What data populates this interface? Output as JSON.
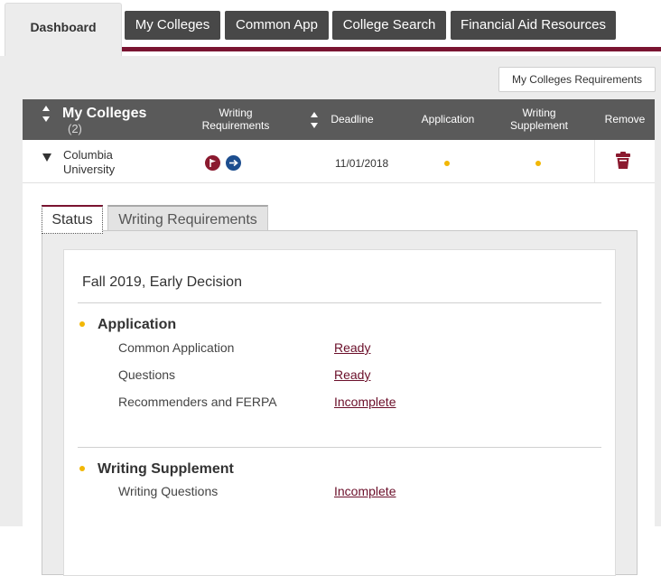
{
  "nav": {
    "tabs": [
      {
        "label": "Dashboard",
        "active": true
      },
      {
        "label": "My Colleges"
      },
      {
        "label": "Common App"
      },
      {
        "label": "College Search"
      },
      {
        "label": "Financial Aid Resources"
      }
    ]
  },
  "colors": {
    "accent": "#7a1431",
    "tab_bg": "#484848",
    "header_bg": "#5a5a5a",
    "status_dot": "#f2b705"
  },
  "requirements_button": "My Colleges Requirements",
  "table": {
    "title": "My Colleges",
    "count": "(2)",
    "columns": {
      "writing_requirements": "Writing Requirements",
      "deadline": "Deadline",
      "application": "Application",
      "writing_supplement": "Writing Supplement",
      "remove": "Remove"
    },
    "rows": [
      {
        "college": "Columbia University",
        "writing_icons": [
          "flag-icon",
          "arrow-icon"
        ],
        "deadline": "11/01/2018",
        "application_status": "in-progress",
        "writing_supplement_status": "in-progress",
        "remove_icon": "trash-icon"
      }
    ]
  },
  "detail": {
    "tabs": [
      "Status",
      "Writing Requirements"
    ],
    "term": "Fall 2019, Early Decision",
    "sections": [
      {
        "title": "Application",
        "items": [
          {
            "label": "Common Application",
            "status": "Ready"
          },
          {
            "label": "Questions",
            "status": "Ready"
          },
          {
            "label": "Recommenders and FERPA",
            "status": "Incomplete"
          }
        ]
      },
      {
        "title": "Writing Supplement",
        "items": [
          {
            "label": "Writing Questions",
            "status": "Incomplete"
          }
        ]
      }
    ]
  }
}
